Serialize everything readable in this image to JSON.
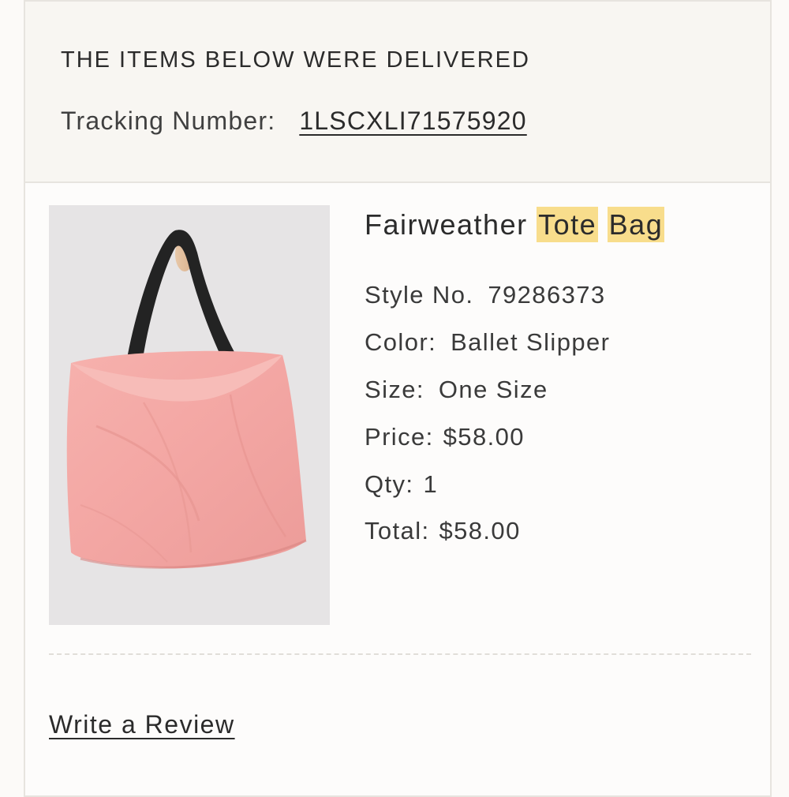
{
  "delivery": {
    "heading": "THE ITEMS BELOW WERE DELIVERED",
    "tracking_label": "Tracking Number:",
    "tracking_number": "1LSCXLI71575920"
  },
  "product": {
    "name_prefix": "Fairweather",
    "name_highlight_1": "Tote",
    "name_highlight_2": "Bag",
    "image_icon": "pink-tote-bag-photo",
    "highlight_color": "#f8dd8c",
    "details": {
      "style_label": "Style No.",
      "style_value": "79286373",
      "color_label": "Color:",
      "color_value": "Ballet Slipper",
      "size_label": "Size:",
      "size_value": "One Size",
      "price_label": "Price:",
      "price_value": "$58.00",
      "qty_label": "Qty:",
      "qty_value": "1",
      "total_label": "Total:",
      "total_value": "$58.00"
    }
  },
  "actions": {
    "write_review": "Write a Review"
  }
}
